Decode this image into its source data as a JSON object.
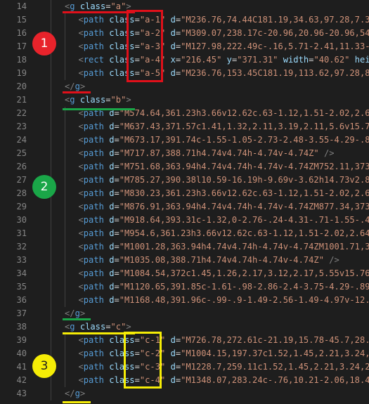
{
  "colors": {
    "background": "#1e1e1e",
    "line_number": "#858585",
    "tag": "#569cd6",
    "attribute": "#9cdcfe",
    "string": "#ce9178",
    "punctuation": "#808080",
    "annotation_red": "#e0101a",
    "annotation_green": "#1aa648",
    "annotation_yellow": "#f5ec06"
  },
  "badges": [
    {
      "label": "1",
      "color": "#e8232b",
      "text_color": "#ffffff"
    },
    {
      "label": "2",
      "color": "#1aa648",
      "text_color": "#ffffff"
    },
    {
      "label": "3",
      "color": "#f5ec06",
      "text_color": "#1e1e1e"
    }
  ],
  "lines": [
    {
      "n": "14",
      "indent": 1,
      "tokens": [
        [
          "p",
          "<"
        ],
        [
          "t",
          "g"
        ],
        [
          "d",
          " "
        ],
        [
          "a",
          "class"
        ],
        [
          "d",
          "="
        ],
        [
          "s",
          "\"a\""
        ],
        [
          "p",
          ">"
        ]
      ]
    },
    {
      "n": "15",
      "indent": 2,
      "tokens": [
        [
          "p",
          "<"
        ],
        [
          "t",
          "path"
        ],
        [
          "d",
          " "
        ],
        [
          "a",
          "class"
        ],
        [
          "d",
          "="
        ],
        [
          "s",
          "\"a-1\""
        ],
        [
          "d",
          " "
        ],
        [
          "a",
          "d"
        ],
        [
          "d",
          "="
        ],
        [
          "s",
          "\"M236.76,74.44C181.19,34.63,97.28,7.32"
        ]
      ]
    },
    {
      "n": "16",
      "indent": 2,
      "tokens": [
        [
          "p",
          "<"
        ],
        [
          "t",
          "path"
        ],
        [
          "d",
          " "
        ],
        [
          "a",
          "class"
        ],
        [
          "d",
          "="
        ],
        [
          "s",
          "\"a-2\""
        ],
        [
          "d",
          " "
        ],
        [
          "a",
          "d"
        ],
        [
          "d",
          "="
        ],
        [
          "s",
          "\"M309.07,238.17c-20.96,20.96-20.96,54.9"
        ]
      ]
    },
    {
      "n": "17",
      "indent": 2,
      "tokens": [
        [
          "p",
          "<"
        ],
        [
          "t",
          "path"
        ],
        [
          "d",
          " "
        ],
        [
          "a",
          "class"
        ],
        [
          "d",
          "="
        ],
        [
          "s",
          "\"a-3\""
        ],
        [
          "d",
          " "
        ],
        [
          "a",
          "d"
        ],
        [
          "d",
          "="
        ],
        [
          "s",
          "\"M127.98,222.49c-.16,5.71-2.41,11.33-6"
        ]
      ]
    },
    {
      "n": "18",
      "indent": 2,
      "tokens": [
        [
          "p",
          "<"
        ],
        [
          "t",
          "rect"
        ],
        [
          "d",
          " "
        ],
        [
          "a",
          "class"
        ],
        [
          "d",
          "="
        ],
        [
          "s",
          "\"a-4\""
        ],
        [
          "d",
          " "
        ],
        [
          "a",
          "x"
        ],
        [
          "d",
          "="
        ],
        [
          "s",
          "\"216.45\""
        ],
        [
          "d",
          " "
        ],
        [
          "a",
          "y"
        ],
        [
          "d",
          "="
        ],
        [
          "s",
          "\"371.31\""
        ],
        [
          "d",
          " "
        ],
        [
          "a",
          "width"
        ],
        [
          "d",
          "="
        ],
        [
          "s",
          "\"40.62\""
        ],
        [
          "d",
          " "
        ],
        [
          "a",
          "height"
        ]
      ]
    },
    {
      "n": "19",
      "indent": 2,
      "tokens": [
        [
          "p",
          "<"
        ],
        [
          "t",
          "path"
        ],
        [
          "d",
          " "
        ],
        [
          "a",
          "class"
        ],
        [
          "d",
          "="
        ],
        [
          "s",
          "\"a-5\""
        ],
        [
          "d",
          " "
        ],
        [
          "a",
          "d"
        ],
        [
          "d",
          "="
        ],
        [
          "s",
          "\"M236.76,153.45C181.19,113.62,97.28,86"
        ]
      ]
    },
    {
      "n": "20",
      "indent": 1,
      "tokens": [
        [
          "p",
          "</"
        ],
        [
          "t",
          "g"
        ],
        [
          "p",
          ">"
        ]
      ]
    },
    {
      "n": "21",
      "indent": 1,
      "tokens": [
        [
          "p",
          "<"
        ],
        [
          "t",
          "g"
        ],
        [
          "d",
          " "
        ],
        [
          "a",
          "class"
        ],
        [
          "d",
          "="
        ],
        [
          "s",
          "\"b\""
        ],
        [
          "p",
          ">"
        ]
      ]
    },
    {
      "n": "22",
      "indent": 2,
      "tokens": [
        [
          "p",
          "<"
        ],
        [
          "t",
          "path"
        ],
        [
          "d",
          " "
        ],
        [
          "a",
          "d"
        ],
        [
          "d",
          "="
        ],
        [
          "s",
          "\"M574.64,361.23h3.66v12.62c.63-1.12,1.51-2.02,2.64"
        ]
      ]
    },
    {
      "n": "23",
      "indent": 2,
      "tokens": [
        [
          "p",
          "<"
        ],
        [
          "t",
          "path"
        ],
        [
          "d",
          " "
        ],
        [
          "a",
          "d"
        ],
        [
          "d",
          "="
        ],
        [
          "s",
          "\"M637.43,371.57c1.41,1.32,2.11,3.19,2.11,5.6v15.72"
        ]
      ]
    },
    {
      "n": "24",
      "indent": 2,
      "tokens": [
        [
          "p",
          "<"
        ],
        [
          "t",
          "path"
        ],
        [
          "d",
          " "
        ],
        [
          "a",
          "d"
        ],
        [
          "d",
          "="
        ],
        [
          "s",
          "\"M673.17,391.74c-1.55-1.05-2.73-2.48-3.55-4.29-.82"
        ]
      ]
    },
    {
      "n": "25",
      "indent": 2,
      "tokens": [
        [
          "p",
          "<"
        ],
        [
          "t",
          "path"
        ],
        [
          "d",
          " "
        ],
        [
          "a",
          "d"
        ],
        [
          "d",
          "="
        ],
        [
          "s",
          "\"M717.87,388.71h4.74v4.74h-4.74v-4.74Z\""
        ],
        [
          "d",
          " "
        ],
        [
          "p",
          "/>"
        ]
      ]
    },
    {
      "n": "26",
      "indent": 2,
      "tokens": [
        [
          "p",
          "<"
        ],
        [
          "t",
          "path"
        ],
        [
          "d",
          " "
        ],
        [
          "a",
          "d"
        ],
        [
          "d",
          "="
        ],
        [
          "s",
          "\"M751.68,363.94h4.74v4.74h-4.74v-4.74ZM752.11,373."
        ]
      ]
    },
    {
      "n": "27",
      "indent": 2,
      "tokens": [
        [
          "p",
          "<"
        ],
        [
          "t",
          "path"
        ],
        [
          "d",
          " "
        ],
        [
          "a",
          "d"
        ],
        [
          "d",
          "="
        ],
        [
          "s",
          "\"M785.27,390.38l10.59-16.19h-9.69v-3.62h14.73v2.83"
        ]
      ]
    },
    {
      "n": "28",
      "indent": 2,
      "tokens": [
        [
          "p",
          "<"
        ],
        [
          "t",
          "path"
        ],
        [
          "d",
          " "
        ],
        [
          "a",
          "d"
        ],
        [
          "d",
          "="
        ],
        [
          "s",
          "\"M830.23,361.23h3.66v12.62c.63-1.12,1.51-2.02,2.64"
        ]
      ]
    },
    {
      "n": "29",
      "indent": 2,
      "tokens": [
        [
          "p",
          "<"
        ],
        [
          "t",
          "path"
        ],
        [
          "d",
          " "
        ],
        [
          "a",
          "d"
        ],
        [
          "d",
          "="
        ],
        [
          "s",
          "\"M876.91,363.94h4.74v4.74h-4.74v-4.74ZM877.34,373."
        ]
      ]
    },
    {
      "n": "30",
      "indent": 2,
      "tokens": [
        [
          "p",
          "<"
        ],
        [
          "t",
          "path"
        ],
        [
          "d",
          " "
        ],
        [
          "a",
          "d"
        ],
        [
          "d",
          "="
        ],
        [
          "s",
          "\"M918.64,393.31c-1.32,0-2.76-.24-4.31-.71-1.55-.47"
        ]
      ]
    },
    {
      "n": "31",
      "indent": 2,
      "tokens": [
        [
          "p",
          "<"
        ],
        [
          "t",
          "path"
        ],
        [
          "d",
          " "
        ],
        [
          "a",
          "d"
        ],
        [
          "d",
          "="
        ],
        [
          "s",
          "\"M954.6,361.23h3.66v12.62c.63-1.12,1.51-2.02,2.64-"
        ]
      ]
    },
    {
      "n": "32",
      "indent": 2,
      "tokens": [
        [
          "p",
          "<"
        ],
        [
          "t",
          "path"
        ],
        [
          "d",
          " "
        ],
        [
          "a",
          "d"
        ],
        [
          "d",
          "="
        ],
        [
          "s",
          "\"M1001.28,363.94h4.74v4.74h-4.74v-4.74ZM1001.71,37"
        ]
      ]
    },
    {
      "n": "33",
      "indent": 2,
      "tokens": [
        [
          "p",
          "<"
        ],
        [
          "t",
          "path"
        ],
        [
          "d",
          " "
        ],
        [
          "a",
          "d"
        ],
        [
          "d",
          "="
        ],
        [
          "s",
          "\"M1035.08,388.71h4.74v4.74h-4.74v-4.74Z\""
        ],
        [
          "d",
          " "
        ],
        [
          "p",
          "/>"
        ]
      ]
    },
    {
      "n": "34",
      "indent": 2,
      "tokens": [
        [
          "p",
          "<"
        ],
        [
          "t",
          "path"
        ],
        [
          "d",
          " "
        ],
        [
          "a",
          "d"
        ],
        [
          "d",
          "="
        ],
        [
          "s",
          "\"M1084.54,372c1.45,1.26,2.17,3.12,2.17,5.55v15.76h"
        ]
      ]
    },
    {
      "n": "35",
      "indent": 2,
      "tokens": [
        [
          "p",
          "<"
        ],
        [
          "t",
          "path"
        ],
        [
          "d",
          " "
        ],
        [
          "a",
          "d"
        ],
        [
          "d",
          "="
        ],
        [
          "s",
          "\"M1120.65,391.85c-1.61-.98-2.86-2.4-3.75-4.29-.89-"
        ]
      ]
    },
    {
      "n": "36",
      "indent": 2,
      "tokens": [
        [
          "p",
          "<"
        ],
        [
          "t",
          "path"
        ],
        [
          "d",
          " "
        ],
        [
          "a",
          "d"
        ],
        [
          "d",
          "="
        ],
        [
          "s",
          "\"M1168.48,391.96c-.99-.9-1.49-2.56-1.49-4.97v-12.6"
        ]
      ]
    },
    {
      "n": "37",
      "indent": 1,
      "tokens": [
        [
          "p",
          "</"
        ],
        [
          "t",
          "g"
        ],
        [
          "p",
          ">"
        ]
      ]
    },
    {
      "n": "38",
      "indent": 1,
      "tokens": [
        [
          "p",
          "<"
        ],
        [
          "t",
          "g"
        ],
        [
          "d",
          " "
        ],
        [
          "a",
          "class"
        ],
        [
          "d",
          "="
        ],
        [
          "s",
          "\"c\""
        ],
        [
          "p",
          ">"
        ]
      ]
    },
    {
      "n": "39",
      "indent": 2,
      "tokens": [
        [
          "p",
          "<"
        ],
        [
          "t",
          "path"
        ],
        [
          "d",
          " "
        ],
        [
          "a",
          "class"
        ],
        [
          "d",
          "="
        ],
        [
          "s",
          "\"c-1\""
        ],
        [
          "d",
          " "
        ],
        [
          "a",
          "d"
        ],
        [
          "d",
          "="
        ],
        [
          "s",
          "\"M726.78,272.61c-21.19,15.78-45.7,28.0"
        ]
      ]
    },
    {
      "n": "40",
      "indent": 2,
      "tokens": [
        [
          "p",
          "<"
        ],
        [
          "t",
          "path"
        ],
        [
          "d",
          " "
        ],
        [
          "a",
          "class"
        ],
        [
          "d",
          "="
        ],
        [
          "s",
          "\"c-2\""
        ],
        [
          "d",
          " "
        ],
        [
          "a",
          "d"
        ],
        [
          "d",
          "="
        ],
        [
          "s",
          "\"M1004.15,197.37c1.52,1.45,2.21,3.24,2"
        ]
      ]
    },
    {
      "n": "41",
      "indent": 2,
      "tokens": [
        [
          "p",
          "<"
        ],
        [
          "t",
          "path"
        ],
        [
          "d",
          " "
        ],
        [
          "a",
          "class"
        ],
        [
          "d",
          "="
        ],
        [
          "s",
          "\"c-3\""
        ],
        [
          "d",
          " "
        ],
        [
          "a",
          "d"
        ],
        [
          "d",
          "="
        ],
        [
          "s",
          "\"M1228.7,259.11c1.52,1.45,2.21,3.24,2."
        ]
      ]
    },
    {
      "n": "42",
      "indent": 2,
      "tokens": [
        [
          "p",
          "<"
        ],
        [
          "t",
          "path"
        ],
        [
          "d",
          " "
        ],
        [
          "a",
          "class"
        ],
        [
          "d",
          "="
        ],
        [
          "s",
          "\"c-4\""
        ],
        [
          "d",
          " "
        ],
        [
          "a",
          "d"
        ],
        [
          "d",
          "="
        ],
        [
          "s",
          "\"M1348.07,283.24c-.76,10.21-2.06,18.45"
        ]
      ]
    },
    {
      "n": "43",
      "indent": 1,
      "tokens": [
        [
          "p",
          "</"
        ],
        [
          "t",
          "g"
        ],
        [
          "p",
          ">"
        ]
      ]
    }
  ]
}
